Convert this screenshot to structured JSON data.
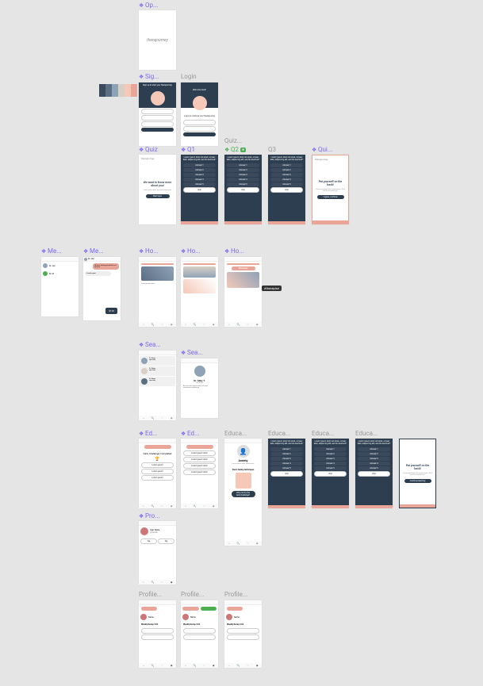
{
  "palette": [
    "#3a4a5c",
    "#5b6e82",
    "#8fa3b8",
    "#d8cfc6",
    "#f5c8b8",
    "#e8a598"
  ],
  "labels": {
    "open": "Op...",
    "signin": "Sig...",
    "login": "Login",
    "quiz": "Quiz",
    "q1": "Q1",
    "quiz_dup": "Quiz...",
    "q2": "Q2",
    "q3": "Q3",
    "quiz_end": "Qui...",
    "me1": "Me...",
    "me2": "Me...",
    "home1": "Ho...",
    "home2": "Ho...",
    "home3": "Ho...",
    "search1": "Sea...",
    "search2": "Sea...",
    "ed1": "Ed...",
    "ed2": "Ed...",
    "educa1": "Educa...",
    "educa2": "Educa...",
    "educa3": "Educa...",
    "educa4": "Educa...",
    "profile1": "Pro...",
    "profile2": "Profile...",
    "profile3": "Profile...",
    "profile4": "Profile..."
  },
  "brand": "therajourney",
  "signin_title": "Sign up to start your therajourney",
  "login_title": "Login to continue your therajourney",
  "quiz_intro": "We want to know more about you!",
  "quiz_question": "Lorem ipsum dolor sit amet, consec tetur, adipiscing elit, sed do eiusmod?",
  "quiz_answers": [
    "Answer 1",
    "Answer 2",
    "Answer 3",
    "Answer 4",
    "Answer 5"
  ],
  "quiz_skip": "skip",
  "quiz_end_title": "Pat yourself on the back!",
  "quiz_end_sub": "You've completed the questionnaire. We'll use this to match you.",
  "quiz_end_btn": "I agree, continue",
  "chat_handle": "Dr. Jaz",
  "chat_price": "$120",
  "start_quiz": "Start Quiz",
  "daily_challenge": "Daily Challenge Completed",
  "anxiety": "Anxiety",
  "anxiety_sub": "Panic feeling techniques",
  "next_up": "Why not try the next challenge?",
  "tooltip": "#therapise"
}
